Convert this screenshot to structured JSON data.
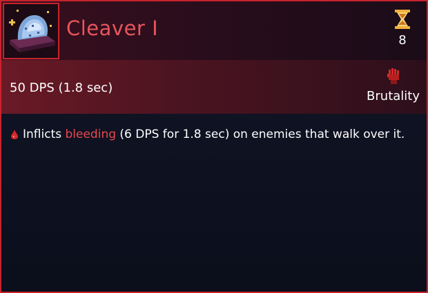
{
  "item": {
    "name": "Cleaver I",
    "icon": "cleaver-trap-icon",
    "cooldown": {
      "icon": "hourglass-icon",
      "value": "8"
    },
    "stats": {
      "dps": "50 DPS (1.8 sec)",
      "scaling_icon": "brutality-fist-icon",
      "scaling_label": "Brutality"
    },
    "effect": {
      "bullet_icon": "blood-drop-icon",
      "prefix": "Inflicts ",
      "keyword": "bleeding",
      "suffix": " (6 DPS for 1.8 sec) on enemies that walk over it."
    }
  },
  "colors": {
    "border": "#c8232c",
    "title": "#e8555c",
    "keyword": "#e8484f",
    "brutality": "#d42a2a",
    "hourglass": "#f0b23a"
  }
}
